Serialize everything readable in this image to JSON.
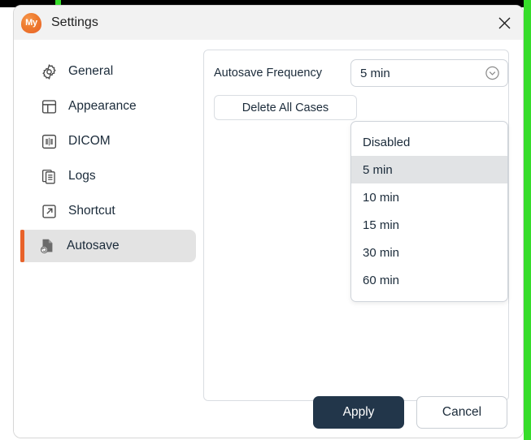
{
  "window": {
    "title": "Settings",
    "logo_text": "My",
    "logo_color": "#e8622a",
    "close_icon": "close-icon"
  },
  "sidebar": {
    "items": [
      {
        "label": "General",
        "icon": "gear-icon",
        "selected": false
      },
      {
        "label": "Appearance",
        "icon": "layout-icon",
        "selected": false
      },
      {
        "label": "DICOM",
        "icon": "dicom-icon",
        "selected": false
      },
      {
        "label": "Logs",
        "icon": "documents-icon",
        "selected": false
      },
      {
        "label": "Shortcut",
        "icon": "arrow-out-icon",
        "selected": false
      },
      {
        "label": "Autosave",
        "icon": "autosave-icon",
        "selected": true
      }
    ],
    "selected_accent_color": "#e8622a",
    "selected_background": "#e3e3e3"
  },
  "content": {
    "autosave_frequency": {
      "label": "Autosave Frequency",
      "selected_value": "5 min",
      "chevron_icon": "chevron-down-circle-icon",
      "options": [
        {
          "label": "Disabled",
          "highlighted": false
        },
        {
          "label": "5 min",
          "highlighted": true
        },
        {
          "label": "10 min",
          "highlighted": false
        },
        {
          "label": "15 min",
          "highlighted": false
        },
        {
          "label": "30 min",
          "highlighted": false
        },
        {
          "label": "60 min",
          "highlighted": false
        }
      ]
    },
    "delete_all_cases_label": "Delete All Cases"
  },
  "footer": {
    "apply_label": "Apply",
    "cancel_label": "Cancel",
    "apply_color": "#22364a"
  }
}
